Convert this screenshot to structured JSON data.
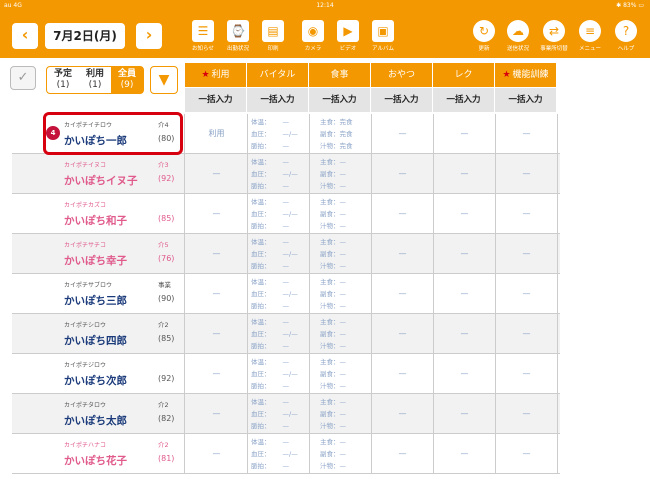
{
  "status": {
    "carrier": "au",
    "network": "4G",
    "time": "12:14",
    "battery": "83%"
  },
  "toolbar": {
    "prev_icon": "chevron-left-icon",
    "next_icon": "chevron-right-icon",
    "date": "7月2日(月)",
    "tools": [
      {
        "label": "お知らせ",
        "icon": "notice-icon"
      },
      {
        "label": "出勤状況",
        "icon": "attendance-icon"
      },
      {
        "label": "印刷",
        "icon": "print-icon"
      },
      {
        "label": "カメラ",
        "icon": "camera-icon"
      },
      {
        "label": "ビデオ",
        "icon": "video-icon"
      },
      {
        "label": "アルバム",
        "icon": "album-icon"
      }
    ],
    "right_tools": [
      {
        "label": "更新",
        "icon": "refresh-icon"
      },
      {
        "label": "送信状況",
        "icon": "cloud-upload-icon"
      },
      {
        "label": "事業所切替",
        "icon": "switch-office-icon"
      },
      {
        "label": "メニュー",
        "icon": "menu-icon"
      },
      {
        "label": "ヘルプ",
        "icon": "help-icon"
      }
    ],
    "accent": "#f39800"
  },
  "filter": {
    "segments": [
      {
        "label": "予定",
        "count": "(1)"
      },
      {
        "label": "利用",
        "count": "(1)"
      },
      {
        "label": "全員",
        "count": "(9)"
      }
    ],
    "active_segment": "全員"
  },
  "columns": [
    {
      "label": "利用",
      "star": "★",
      "bulk": "一括入力"
    },
    {
      "label": "バイタル",
      "star": "",
      "bulk": "一括入力"
    },
    {
      "label": "食事",
      "star": "",
      "bulk": "一括入力"
    },
    {
      "label": "おやつ",
      "star": "",
      "bulk": "一括入力"
    },
    {
      "label": "レク",
      "star": "",
      "bulk": "一括入力"
    },
    {
      "label": "機能訓練",
      "star": "★",
      "bulk": "一括入力"
    }
  ],
  "labels": {
    "temp": "体温：",
    "bp": "血圧：",
    "pulse": "脈拍：",
    "staple": "主食：",
    "side": "副食：",
    "soup": "汁物：",
    "dash": "—",
    "bp_dash": "—/—"
  },
  "residents": [
    {
      "kana": "カイポチイチロウ",
      "care": "介4",
      "name": "かいぽち一郎",
      "age": "(80)",
      "gender": "m",
      "use": "利用",
      "meal": [
        "完食",
        "完食",
        "完食"
      ],
      "badge": "4"
    },
    {
      "kana": "カイポチイヌコ",
      "care": "介3",
      "name": "かいぽちイヌ子",
      "age": "(92)",
      "gender": "f",
      "use": "—",
      "meal": [
        "—",
        "—",
        "—"
      ],
      "badge": ""
    },
    {
      "kana": "カイポチカズコ",
      "care": "",
      "name": "かいぽち和子",
      "age": "(85)",
      "gender": "f",
      "use": "—",
      "meal": [
        "—",
        "—",
        "—"
      ],
      "badge": ""
    },
    {
      "kana": "カイポチサチコ",
      "care": "介5",
      "name": "かいぽち幸子",
      "age": "(76)",
      "gender": "f",
      "use": "—",
      "meal": [
        "—",
        "—",
        "—"
      ],
      "badge": ""
    },
    {
      "kana": "カイポチサブロウ",
      "care": "事業",
      "name": "かいぽち三郎",
      "age": "(90)",
      "gender": "m",
      "use": "—",
      "meal": [
        "—",
        "—",
        "—"
      ],
      "badge": ""
    },
    {
      "kana": "カイポチシロウ",
      "care": "介2",
      "name": "かいぽち四郎",
      "age": "(85)",
      "gender": "m",
      "use": "—",
      "meal": [
        "—",
        "—",
        "—"
      ],
      "badge": ""
    },
    {
      "kana": "カイポチジロウ",
      "care": "",
      "name": "かいぽち次郎",
      "age": "(92)",
      "gender": "m",
      "use": "—",
      "meal": [
        "—",
        "—",
        "—"
      ],
      "badge": ""
    },
    {
      "kana": "カイポチタロウ",
      "care": "介2",
      "name": "かいぽち太郎",
      "age": "(82)",
      "gender": "m",
      "use": "—",
      "meal": [
        "—",
        "—",
        "—"
      ],
      "badge": ""
    },
    {
      "kana": "カイポチハナコ",
      "care": "介2",
      "name": "かいぽち花子",
      "age": "(81)",
      "gender": "f",
      "use": "—",
      "meal": [
        "—",
        "—",
        "—"
      ],
      "badge": ""
    }
  ],
  "colors": {
    "female": "#e05a8c",
    "male_name": "#1a3a7a",
    "highlight": "#d7000f",
    "badge": "#c4123a"
  }
}
